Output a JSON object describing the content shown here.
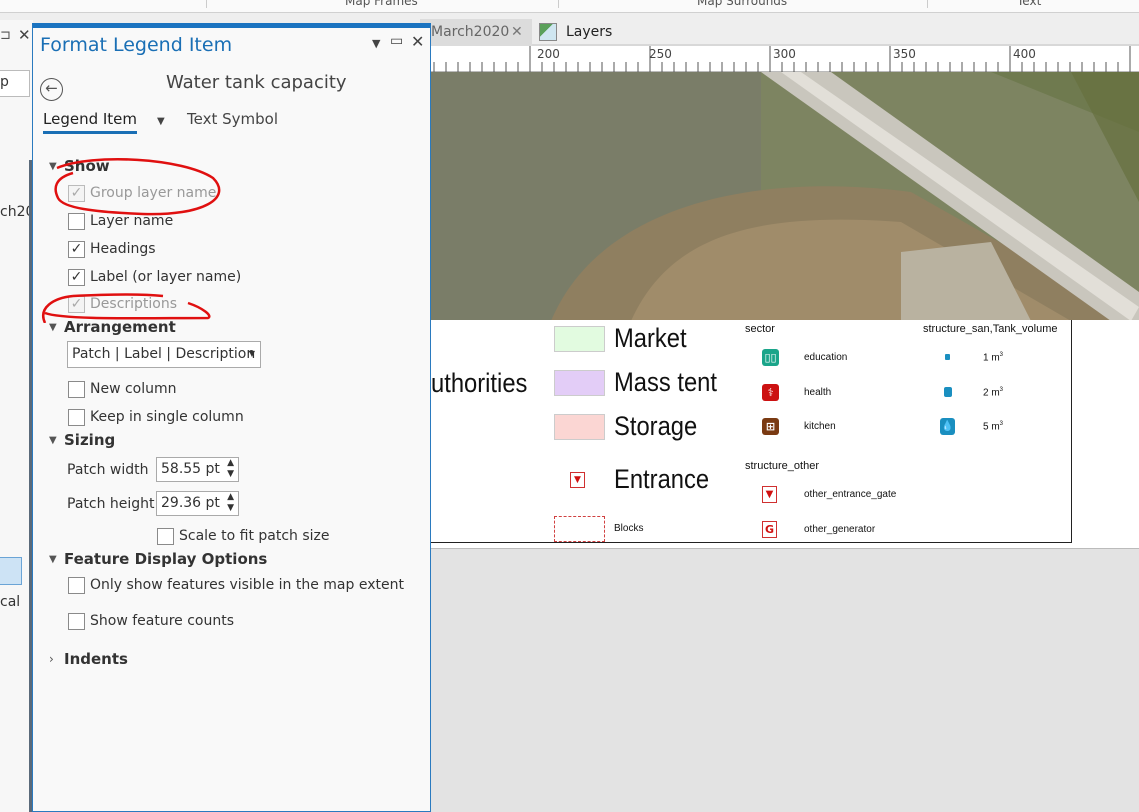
{
  "ribbon": {
    "groups": [
      "Map Frames",
      "Map Surrounds",
      "Text"
    ]
  },
  "tabs": [
    {
      "label": "March2020",
      "close": "✕"
    },
    {
      "label": "Layers"
    }
  ],
  "left_strip": {
    "fragments": [
      "p",
      "ch20",
      "cal"
    ]
  },
  "panel": {
    "title": "Format Legend Item",
    "subtitle": "Water tank capacity",
    "tabs": [
      {
        "label": "Legend Item",
        "active": true
      },
      {
        "label": "Text Symbol"
      }
    ],
    "show": {
      "label": "Show",
      "items": [
        {
          "label": "Group layer name",
          "checked": true,
          "disabled": true
        },
        {
          "label": "Layer name",
          "checked": false
        },
        {
          "label": "Headings",
          "checked": true
        },
        {
          "label": "Label (or layer name)",
          "checked": true
        },
        {
          "label": "Descriptions",
          "checked": true,
          "disabled": true
        }
      ]
    },
    "arrangement": {
      "label": "Arrangement",
      "value": "Patch | Label | Description",
      "new_column": "New column",
      "single_column": "Keep in single column"
    },
    "sizing": {
      "label": "Sizing",
      "patch_width_label": "Patch width",
      "patch_width": "58.55 pt",
      "patch_height_label": "Patch height",
      "patch_height": "29.36 pt",
      "scale_label": "Scale to fit patch size"
    },
    "feature_display": {
      "label": "Feature Display Options",
      "visible_only": "Only show features visible in the map extent",
      "counts": "Show feature counts"
    },
    "indents": {
      "label": "Indents"
    }
  },
  "ruler": [
    "200",
    "250",
    "300",
    "350",
    "400"
  ],
  "legend": {
    "partial_label": "uthorities",
    "items": [
      {
        "label": "Market",
        "color": "#e2fbe0"
      },
      {
        "label": "Mass tent",
        "color": "#e3cdf7"
      },
      {
        "label": "Storage",
        "color": "#fbd6d3"
      },
      {
        "label": "Entrance"
      },
      {
        "label": "Blocks"
      }
    ],
    "sector": {
      "heading": "sector",
      "items": [
        {
          "label": "education",
          "color": "#1aa58a"
        },
        {
          "label": "health",
          "color": "#cc1111"
        },
        {
          "label": "kitchen",
          "color": "#7a3a12"
        }
      ]
    },
    "structure_other": {
      "heading": "structure_other",
      "items": [
        {
          "label": "other_entrance_gate"
        },
        {
          "label": "other_generator"
        }
      ]
    },
    "tank": {
      "heading": "structure_san,Tank_volume",
      "items": [
        {
          "label": "1 m",
          "sup": "3"
        },
        {
          "label": "2 m",
          "sup": "3"
        },
        {
          "label": "5 m",
          "sup": "3"
        }
      ],
      "color": "#1a8fc0"
    }
  }
}
